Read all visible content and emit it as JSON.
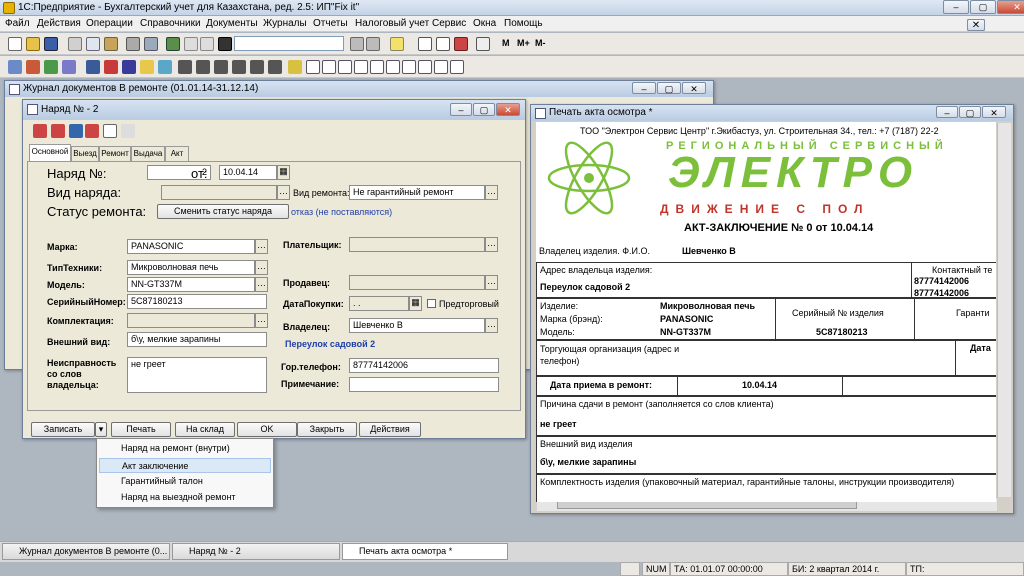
{
  "app": {
    "title": "1С:Предприятие - Бухгалтерский учет для Казахстана, ред. 2.5: ИП\"Fix it\""
  },
  "menu": [
    "Файл",
    "Действия",
    "Операции",
    "Справочники",
    "Документы",
    "Журналы",
    "Отчеты",
    "Налоговый учет",
    "Сервис",
    "Окна",
    "Помощь"
  ],
  "toolbar": {
    "m_buttons": [
      "M",
      "M+",
      "M-"
    ]
  },
  "journal": {
    "title": "Журнал документов  В ремонте (01.01.14-31.12.14)"
  },
  "order": {
    "title": "Наряд № - 2",
    "tabs": [
      "Основной",
      "Выезд",
      "Ремонт",
      "Выдача",
      "Акт"
    ],
    "number_label": "Наряд №:",
    "number": "2",
    "from_label": "от:",
    "date": "10.04.14",
    "kind_label": "Вид наряда:",
    "repair_kind_label": "Вид ремонта:",
    "repair_kind": "Не гарантийный ремонт",
    "status_label": "Статус ремонта:",
    "status_button": "Сменить статус наряда",
    "status_value": "отказ (не поставляются)",
    "brand_label": "Марка:",
    "brand": "PANASONIC",
    "type_label": "ТипТехники:",
    "type": "Микроволновая печь",
    "model_label": "Модель:",
    "model": "NN-GT337M",
    "serial_label": "СерийныйНомер:",
    "serial": "5C87180213",
    "kit_label": "Комплектация:",
    "view_label": "Внешний вид:",
    "view": "б\\у, мелкие зарапины",
    "fault_label": "Неисправность со слов владельца:",
    "fault": "не греет",
    "payer_label": "Плательщик:",
    "seller_label": "Продавец:",
    "purchase_label": "ДатаПокупки:",
    "purchase_date": " .  .",
    "pretrade_label": "Предторговый",
    "owner_label": "Владелец:",
    "owner": "Шевченко В",
    "address": "Переулок садовой 2",
    "phone_label": "Гор.телефон:",
    "phone": "87774142006",
    "note_label": "Примечание:",
    "buttons": {
      "save": "Записать",
      "print": "Печать",
      "stock": "На склад",
      "ok": "OK",
      "close": "Закрыть",
      "actions": "Действия"
    }
  },
  "dropdown": [
    "Наряд на ремонт (внутри)",
    "Акт заключение",
    "Гарантийный талон",
    "Наряд на выездной ремонт"
  ],
  "print_window": {
    "title": "Печать акта осмотра  *",
    "company": "ТОО \"Электрон Сервис Центр\" г.Экибастуз, ул. Строительная 34., тел.: +7 (7187) 22-2",
    "logo_top": "РЕГИОНАЛЬНЫЙ СЕРВИСНЫЙ",
    "logo_main": "ЭЛЕКТРО",
    "logo_bottom": "ДВИЖЕНИЕ С ПОЛ",
    "act_title": "АКТ-ЗАКЛЮЧЕНИЕ № 0 от 10.04.14",
    "owner_label": "Владелец изделия. Ф.И.О.",
    "owner": "Шевченко В",
    "address_label": "Адрес владельца изделия:",
    "address": "Переулок садовой 2",
    "contact_label": "Контактный те",
    "phone1": "87774142006",
    "phone2": "87774142006",
    "item_label": "Изделие:",
    "item": "Микроволновая печь",
    "brand_label": "Марка (брэнд):",
    "brand": "PANASONIC",
    "model_label": "Модель:",
    "model": "NN-GT337M",
    "serial_label": "Серийный № изделия",
    "serial": "5C87180213",
    "warranty_label": "Гаранти",
    "trade_label": "Торгующая организация (адрес и телефон)",
    "date_short": "Дата",
    "receive_label": "Дата приема в ремонт:",
    "receive_date": "10.04.14",
    "reason_label": "Причина сдачи в ремонт (заполняется со слов клиента)",
    "reason": "не греет",
    "appearance_label": "Внешний вид изделия",
    "appearance": "б\\у, мелкие зарапины",
    "kit_label": "Комплектность изделия (упаковочный материал, гарантийные талоны, инструкции производителя)"
  },
  "taskbar": [
    "Журнал документов  В ремонте (0...",
    "Наряд № - 2",
    "Печать акта осмотра  *"
  ],
  "statusbar": {
    "num": "NUM",
    "ta": "ТА: 01.01.07  00:00:00",
    "bi": "БИ: 2 квартал 2014 г.",
    "tp": "ТП:"
  },
  "colors": {
    "logo_green": "#7bbf3a",
    "logo_red": "#c0342a",
    "link_blue": "#1f3fa8"
  }
}
